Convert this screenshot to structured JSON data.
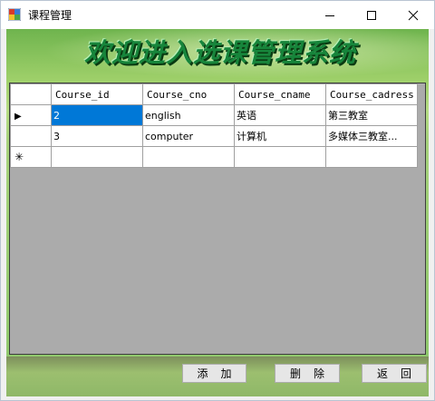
{
  "window": {
    "title": "课程管理",
    "minimize_icon": "minimize-icon",
    "maximize_icon": "maximize-icon",
    "close_icon": "close-icon"
  },
  "banner": {
    "text": "欢迎进入选课管理系统"
  },
  "grid": {
    "columns": [
      "Course_id",
      "Course_cno",
      "Course_cname",
      "Course_cadress"
    ],
    "rows": [
      [
        "2",
        "english",
        "英语",
        "第三教室"
      ],
      [
        "3",
        "computer",
        "计算机",
        "多媒体三教室..."
      ]
    ],
    "current_row_marker": "▶",
    "new_row_marker": "✳",
    "selection_color": "#0078d7"
  },
  "buttons": {
    "add": "添加",
    "delete": "删除",
    "back": "返回"
  }
}
